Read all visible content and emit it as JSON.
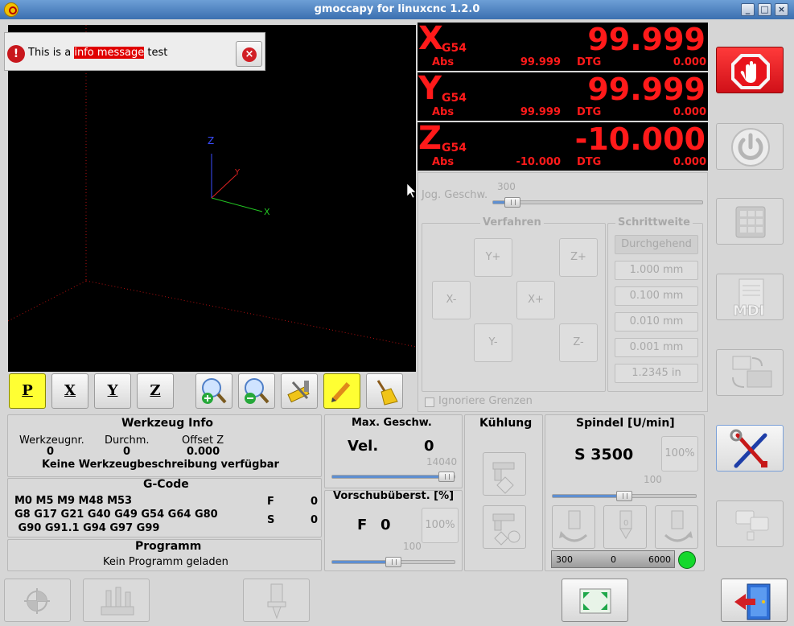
{
  "window": {
    "title": "gmoccapy for linuxcnc   1.2.0"
  },
  "message": {
    "prefix": "This is a ",
    "highlight": "info message",
    "suffix": " test"
  },
  "dro": {
    "coord_system": "G54",
    "abs_label": "Abs",
    "dtg_label": "DTG",
    "axes": [
      {
        "letter": "X",
        "value": "99.999",
        "abs": "99.999",
        "dtg": "0.000"
      },
      {
        "letter": "Y",
        "value": "99.999",
        "abs": "99.999",
        "dtg": "0.000"
      },
      {
        "letter": "Z",
        "value": "-10.000",
        "abs": "-10.000",
        "dtg": "0.000"
      }
    ]
  },
  "view_axes": {
    "x": "X",
    "y": "Y",
    "z": "Z"
  },
  "jog": {
    "speed_label": "Jog. Geschw.",
    "speed_value": "300",
    "speed_fraction": 0.06,
    "verfahren_title": "Verfahren",
    "buttons": {
      "y_plus": "Y+",
      "z_plus": "Z+",
      "x_minus": "X-",
      "x_plus": "X+",
      "y_minus": "Y-",
      "z_minus": "Z-"
    },
    "schrittweite_title": "Schrittweite",
    "increments": [
      "Durchgehend",
      "1.000 mm",
      "0.100 mm",
      "0.010 mm",
      "0.001 mm",
      "1.2345 in"
    ],
    "ignore_limits": "Ignoriere Grenzen"
  },
  "view_toolbar": {
    "view_p": "P",
    "view_x": "X",
    "view_y": "Y",
    "view_z": "Z"
  },
  "tool_info": {
    "title": "Werkzeug Info",
    "tool_no_label": "Werkzeugnr.",
    "tool_no": "0",
    "diameter_label": "Durchm.",
    "diameter": "0",
    "offset_label": "Offset Z",
    "offset": "0.000",
    "description": "Keine Werkzeugbeschreibung verfügbar"
  },
  "gcode": {
    "title": "G-Code",
    "line1": "M0 M5 M9 M48 M53",
    "line2": "G8 G17 G21 G40 G49 G54 G64 G80",
    "line3": " G90 G91.1 G94 G97 G99",
    "f_label": "F",
    "f_value": "0",
    "s_label": "S",
    "s_value": "0"
  },
  "program": {
    "title": "Programm",
    "status": "Kein Programm geladen"
  },
  "max_velocity": {
    "title": "Max. Geschw.",
    "label": "Vel.",
    "value": "0",
    "slider_max": "14040",
    "fraction": 1.0
  },
  "feed_override": {
    "title": "Vorschubüberst. [%]",
    "label": "F",
    "value": "0",
    "reset_label": "100%",
    "slider_value": "100",
    "fraction": 0.5
  },
  "coolant": {
    "title": "Kühlung"
  },
  "spindle": {
    "title": "Spindel [U/min]",
    "speed_text": "S 3500",
    "reset_label": "100%",
    "slider_value": "100",
    "fraction": 0.5,
    "bar_min": "300",
    "bar_value": "0",
    "bar_max": "6000",
    "running_color": "#14d82c"
  },
  "colors": {
    "dro_text": "#ff1a1a",
    "estop": "#e8141c",
    "highlight": "#e00000"
  }
}
